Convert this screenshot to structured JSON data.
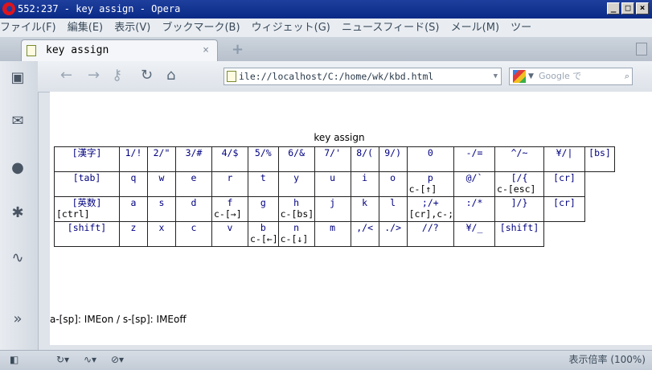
{
  "window": {
    "title": "552:237 - key assign - Opera"
  },
  "menu": [
    "ファイル(F)",
    "編集(E)",
    "表示(V)",
    "ブックマーク(B)",
    "ウィジェット(G)",
    "ニュースフィード(S)",
    "メール(M)",
    "ツー"
  ],
  "tab": {
    "label": "key assign",
    "close": "×",
    "new_tab": "+"
  },
  "nav": {
    "url": "ile://localhost/C:/home/wk/kbd.html",
    "search_placeholder": "Google で"
  },
  "page": {
    "title": "key assign",
    "rows": [
      [
        {
          "t": "[漢字]"
        },
        {
          "t": "1/!"
        },
        {
          "t": "2/\""
        },
        {
          "t": "3/#"
        },
        {
          "t": "4/$"
        },
        {
          "t": "5/%"
        },
        {
          "t": "6/&"
        },
        {
          "t": "7/'"
        },
        {
          "t": "8/("
        },
        {
          "t": "9/)"
        },
        {
          "t": "0"
        },
        {
          "t": "-/="
        },
        {
          "t": "^/~"
        },
        {
          "t": "¥/|"
        },
        {
          "t": "[bs]"
        }
      ],
      [
        {
          "t": "[tab]"
        },
        {
          "t": "q"
        },
        {
          "t": "w"
        },
        {
          "t": "e"
        },
        {
          "t": "r"
        },
        {
          "t": "t"
        },
        {
          "t": "y"
        },
        {
          "t": "u"
        },
        {
          "t": "i"
        },
        {
          "t": "o"
        },
        {
          "t": "p",
          "b": "c-[↑]"
        },
        {
          "t": "@/`"
        },
        {
          "t": "[/{",
          "b": "c-[esc]"
        },
        {
          "t": "[cr]"
        }
      ],
      [
        {
          "t": "[英数]",
          "b": "[ctrl]"
        },
        {
          "t": "a"
        },
        {
          "t": "s"
        },
        {
          "t": "d"
        },
        {
          "t": "f",
          "b": "c-[→]"
        },
        {
          "t": "g"
        },
        {
          "t": "h",
          "b": "c-[bs]"
        },
        {
          "t": "j"
        },
        {
          "t": "k"
        },
        {
          "t": "l"
        },
        {
          "t": ";/+",
          "b": "[cr],c-;"
        },
        {
          "t": ":/*"
        },
        {
          "t": "]/}"
        },
        {
          "t": "[cr]"
        }
      ],
      [
        {
          "t": "[shift]"
        },
        {
          "t": "z"
        },
        {
          "t": "x"
        },
        {
          "t": "c"
        },
        {
          "t": "v"
        },
        {
          "t": "b",
          "b": "c-[←]"
        },
        {
          "t": "n",
          "b": "c-[↓]"
        },
        {
          "t": "m"
        },
        {
          "t": ",/<"
        },
        {
          "t": "./>"
        },
        {
          "t": "//?"
        },
        {
          "t": "¥/_"
        },
        {
          "t": "[shift]"
        }
      ]
    ],
    "note": "a-[sp]: IMEon / s-[sp]: IMEoff"
  },
  "status": {
    "zoom": "表示倍率 (100%)"
  }
}
